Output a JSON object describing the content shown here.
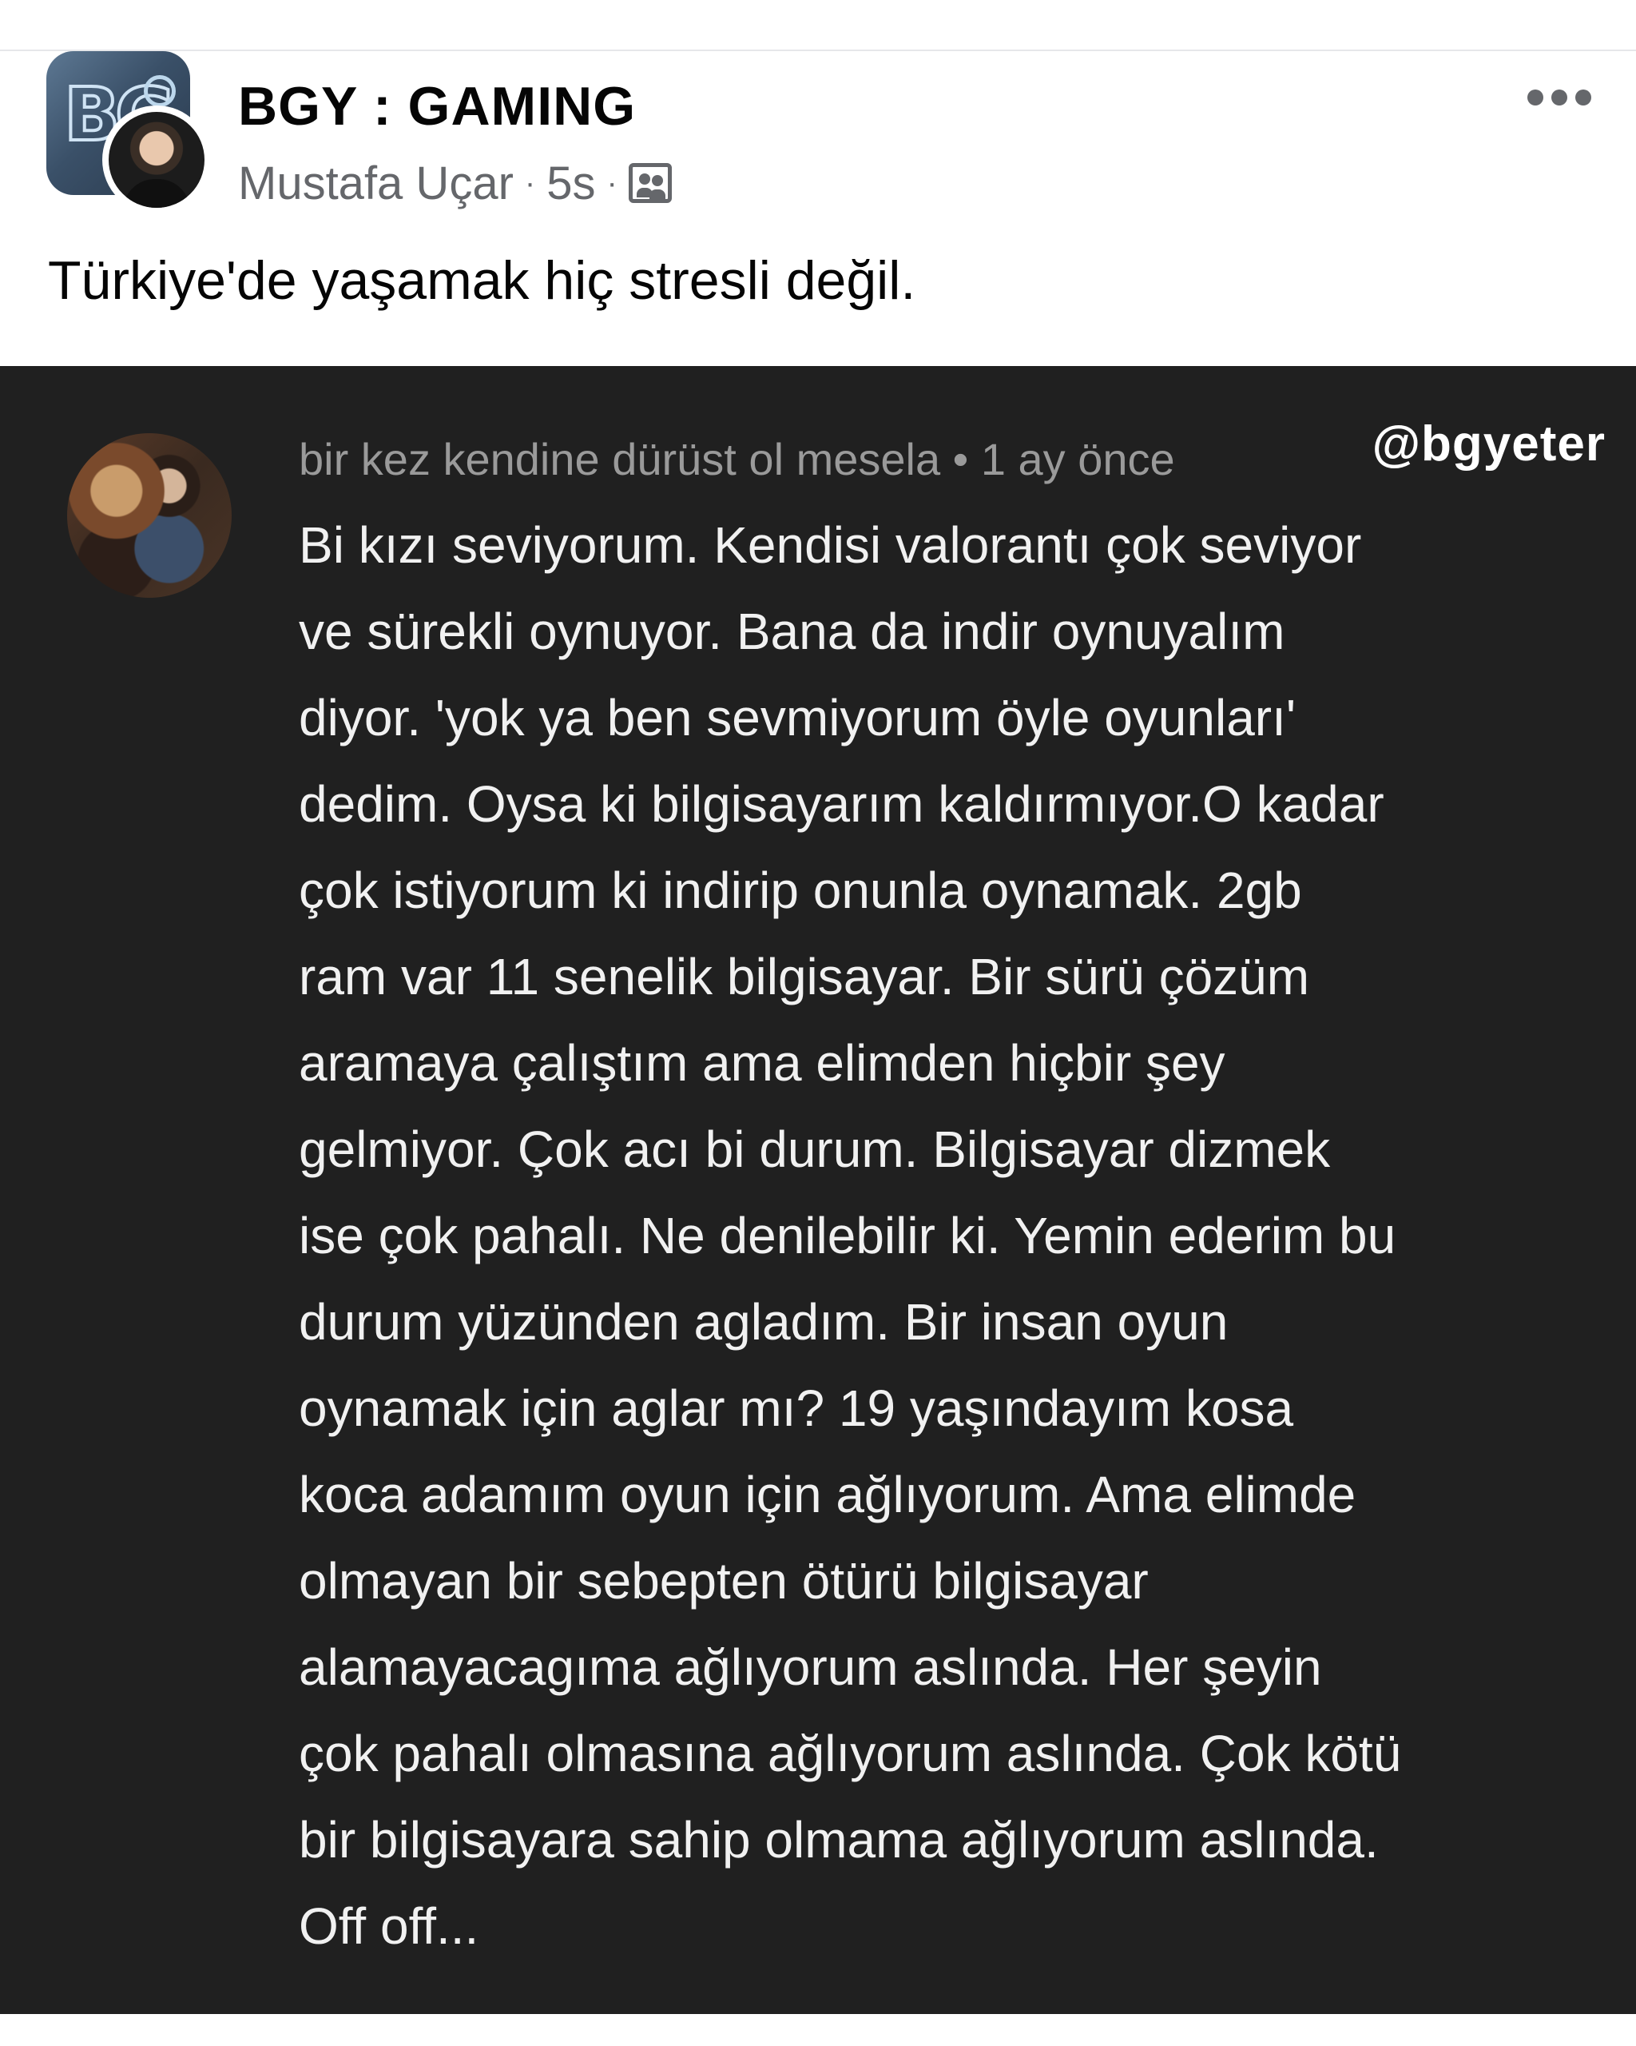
{
  "post": {
    "group_name": "BGY : GAMING",
    "author": "Mustafa Uçar",
    "separator": "·",
    "time": "5s",
    "text": "Türkiye'de yaşamak hiç stresli değil."
  },
  "icons": {
    "group_avatar": "bgy-logo-icon",
    "user_avatar": "profile-photo",
    "privacy": "group-icon",
    "more": "more-options-icon"
  },
  "attachment": {
    "watermark": "@bgyeter",
    "commenter": "bir kez kendine dürüst ol mesela",
    "comment_time": "1 ay önce",
    "comment_lines": [
      "Bi kızı seviyorum. Kendisi valorantı çok seviyor",
      "ve sürekli oynuyor. Bana da indir oynuyalım",
      "diyor. 'yok ya ben sevmiyorum öyle oyunları'",
      "dedim. Oysa ki bilgisayarım kaldırmıyor.O kadar",
      "çok istiyorum ki indirip onunla oynamak. 2gb",
      "ram var 11 senelik bilgisayar. Bir sürü çözüm",
      "aramaya çalıştım ama elimden hiçbir şey",
      "gelmiyor. Çok acı bi durum. Bilgisayar dizmek",
      "ise çok pahalı. Ne denilebilir ki. Yemin ederim bu",
      "durum yüzünden agladım. Bir insan oyun",
      "oynamak için aglar mı? 19 yaşındayım kosa",
      "koca adamım oyun için ağlıyorum. Ama elimde",
      "olmayan bir sebepten ötürü bilgisayar",
      "alamayacagıma ağlıyorum aslında. Her şeyin",
      "çok pahalı olmasına ağlıyorum aslında. Çok kötü",
      "bir bilgisayara sahip olmama ağlıyorum aslında.",
      "Off off..."
    ]
  },
  "colors": {
    "text_primary": "#050505",
    "text_secondary": "#65676b",
    "attachment_background": "#202020",
    "comment_text": "#f1f1f1",
    "comment_meta": "#9a9a9a"
  }
}
